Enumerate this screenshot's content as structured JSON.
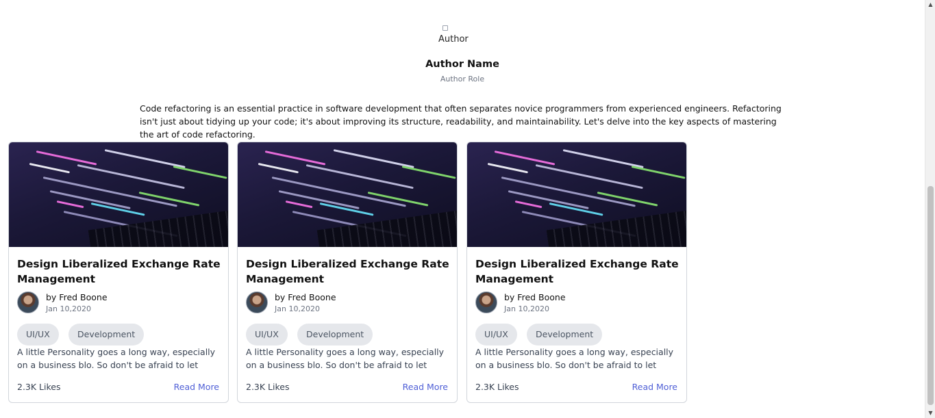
{
  "author": {
    "avatar_alt": "Author",
    "name": "Author Name",
    "role": "Author Role"
  },
  "intro_text": "Code refactoring is an essential practice in software development that often separates novice programmers from experienced engineers. Refactoring isn't just about tidying up your code; it's about improving its structure, readability, and maintainability. Let's delve into the key aspects of mastering the art of code refactoring.",
  "cards": [
    {
      "title": "Design Liberalized Exchange Rate Management",
      "byline": "by Fred Boone",
      "date": "Jan 10,2020",
      "tags": [
        "UI/UX",
        "Development"
      ],
      "description": "A little Personality goes a long way, especially on a business blo. So don't be afraid to let loose",
      "likes": "2.3K Likes",
      "read_more": "Read More"
    },
    {
      "title": "Design Liberalized Exchange Rate Management",
      "byline": "by Fred Boone",
      "date": "Jan 10,2020",
      "tags": [
        "UI/UX",
        "Development"
      ],
      "description": "A little Personality goes a long way, especially on a business blo. So don't be afraid to let loose",
      "likes": "2.3K Likes",
      "read_more": "Read More"
    },
    {
      "title": "Design Liberalized Exchange Rate Management",
      "byline": "by Fred Boone",
      "date": "Jan 10,2020",
      "tags": [
        "UI/UX",
        "Development"
      ],
      "description": "A little Personality goes a long way, especially on a business blo. So don't be afraid to let loose",
      "likes": "2.3K Likes",
      "read_more": "Read More"
    }
  ],
  "colors": {
    "link": "#4f5fd6",
    "tag_bg": "#e5e7eb"
  },
  "icons": {
    "scroll_up": "triangle-up-icon",
    "scroll_down": "triangle-down-icon"
  }
}
